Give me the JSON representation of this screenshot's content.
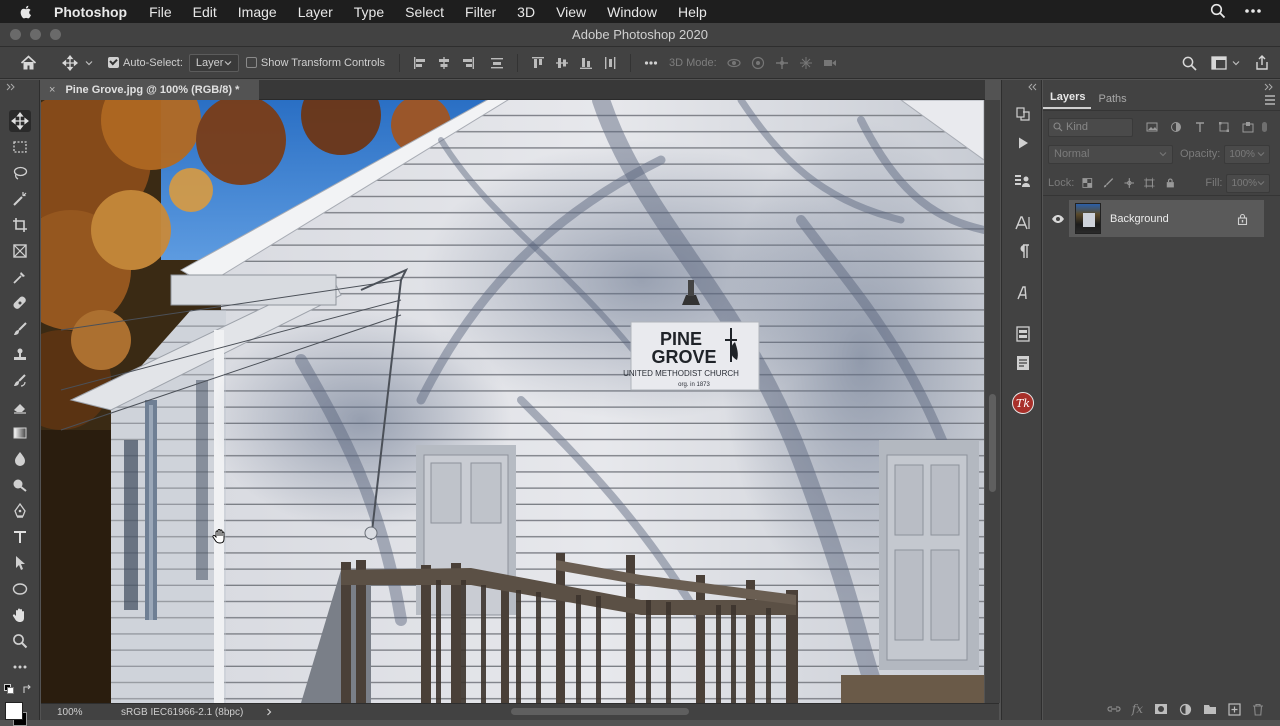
{
  "menubar": {
    "app": "Photoshop",
    "items": [
      "File",
      "Edit",
      "Image",
      "Layer",
      "Type",
      "Select",
      "Filter",
      "3D",
      "View",
      "Window",
      "Help"
    ]
  },
  "window": {
    "title": "Adobe Photoshop 2020"
  },
  "options": {
    "auto_select_label": "Auto-Select:",
    "auto_select_checked": true,
    "auto_select_target": "Layer",
    "show_transform_label": "Show Transform Controls",
    "show_transform_checked": false,
    "mode_3d_label": "3D Mode:"
  },
  "document": {
    "tab_title": "Pine Grove.jpg @ 100% (RGB/8) *",
    "zoom": "100%",
    "color_profile": "sRGB IEC61966-2.1 (8bpc)",
    "sign": {
      "line1": "PINE",
      "line2": "GROVE",
      "line3": "UNITED METHODIST CHURCH",
      "line4": "org. in 1873"
    }
  },
  "layers_panel": {
    "tabs": [
      "Layers",
      "Paths"
    ],
    "filter_kind": "Kind",
    "blend_mode": "Normal",
    "opacity_label": "Opacity:",
    "opacity_value": "100%",
    "lock_label": "Lock:",
    "fill_label": "Fill:",
    "fill_value": "100%",
    "layers": [
      {
        "name": "Background",
        "visible": true,
        "locked": true
      }
    ]
  },
  "dock": {
    "badge_text": "Tk"
  },
  "colors": {
    "accent_badge": "#a8302a",
    "ui_dark": "#424242",
    "ui_mid": "#535353"
  }
}
